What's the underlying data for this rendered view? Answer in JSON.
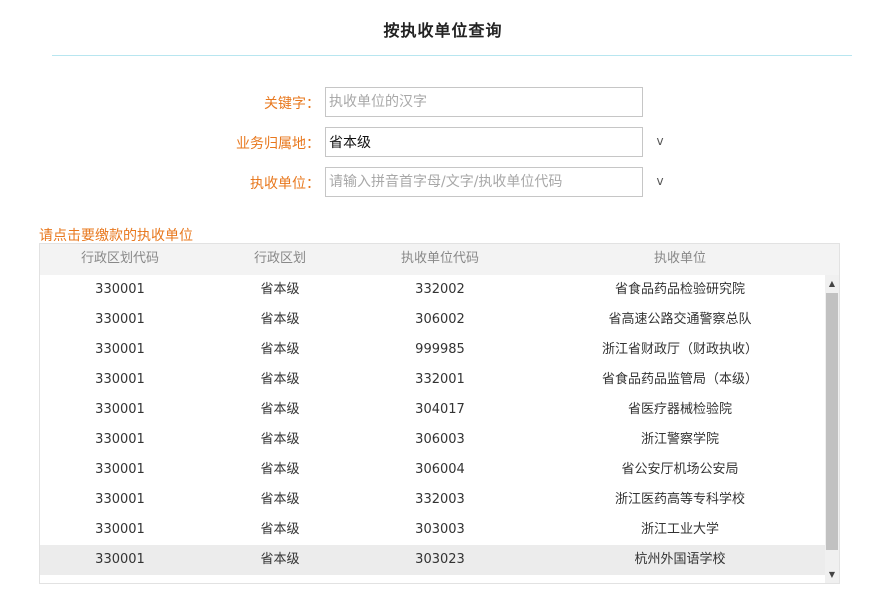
{
  "page": {
    "title": "按执收单位查询"
  },
  "form": {
    "keyword": {
      "label": "关键字：",
      "value": "",
      "placeholder": "执收单位的汉字"
    },
    "region": {
      "label": "业务归属地：",
      "value": "省本级",
      "placeholder": ""
    },
    "unit": {
      "label": "执收单位：",
      "value": "",
      "placeholder": "请输入拼音首字母/文字/执收单位代码"
    },
    "dropdown_glyph": "v"
  },
  "table": {
    "hint": "请点击要缴款的执收单位",
    "headers": [
      "行政区划代码",
      "行政区划",
      "执收单位代码",
      "执收单位"
    ],
    "rows": [
      [
        "330001",
        "省本级",
        "332002",
        "省食品药品检验研究院"
      ],
      [
        "330001",
        "省本级",
        "306002",
        "省高速公路交通警察总队"
      ],
      [
        "330001",
        "省本级",
        "999985",
        "浙江省财政厅（财政执收）"
      ],
      [
        "330001",
        "省本级",
        "332001",
        "省食品药品监管局（本级）"
      ],
      [
        "330001",
        "省本级",
        "304017",
        "省医疗器械检验院"
      ],
      [
        "330001",
        "省本级",
        "306003",
        "浙江警察学院"
      ],
      [
        "330001",
        "省本级",
        "306004",
        "省公安厅机场公安局"
      ],
      [
        "330001",
        "省本级",
        "332003",
        "浙江医药高等专科学校"
      ],
      [
        "330001",
        "省本级",
        "303003",
        "浙江工业大学"
      ],
      [
        "330001",
        "省本级",
        "303023",
        "杭州外国语学校"
      ]
    ],
    "selected_row": 9
  },
  "scrollbar": {
    "up_glyph": "▲",
    "down_glyph": "▼"
  }
}
